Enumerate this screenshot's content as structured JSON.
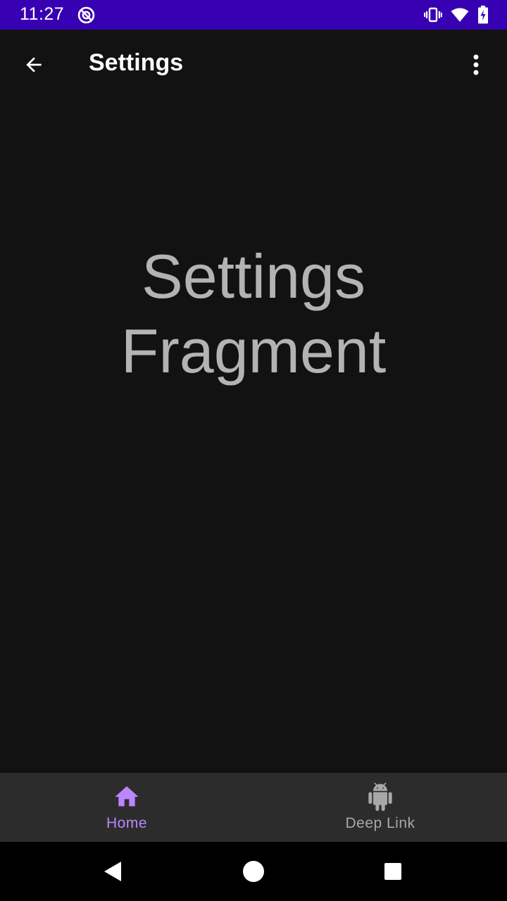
{
  "status_bar": {
    "time": "11:27",
    "color": "#3700b3"
  },
  "app_bar": {
    "title": "Settings",
    "back_icon": "arrow-left-icon",
    "menu_icon": "more-vert-icon"
  },
  "content": {
    "label": "Settings Fragment"
  },
  "bottom_nav": {
    "items": [
      {
        "label": "Home",
        "icon": "home-icon",
        "active": true
      },
      {
        "label": "Deep Link",
        "icon": "android-icon",
        "active": false
      }
    ],
    "active_color": "#bb86fc"
  },
  "system_nav": {
    "buttons": [
      "back-triangle-icon",
      "home-circle-icon",
      "recents-square-icon"
    ]
  }
}
